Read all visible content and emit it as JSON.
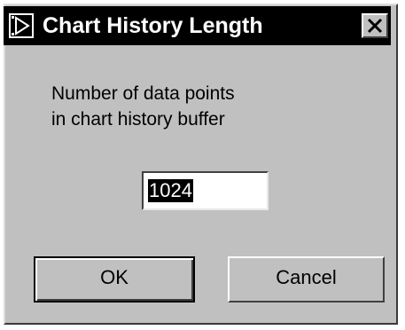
{
  "window": {
    "title": "Chart History Length",
    "icon": "labview-run-icon",
    "close_icon": "close-x-icon"
  },
  "prompt": {
    "text": "Number of data points\nin chart history buffer"
  },
  "input": {
    "value": "1024",
    "selected": true
  },
  "buttons": {
    "ok_label": "OK",
    "cancel_label": "Cancel",
    "default": "OK"
  },
  "colors": {
    "face": "#c0c0c0",
    "titlebar": "#000000",
    "title_text": "#ffffff",
    "selection": "#000000"
  }
}
